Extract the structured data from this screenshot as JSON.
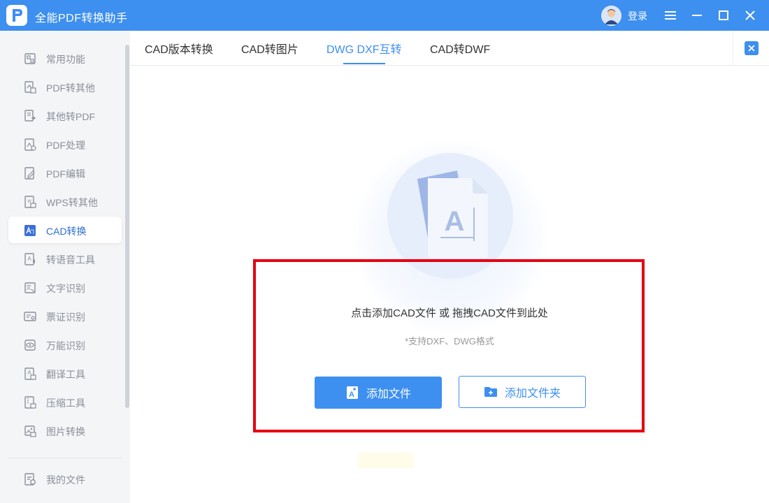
{
  "app": {
    "title": "全能PDF转换助手",
    "login_label": "登录",
    "accent_color": "#3d8ff0"
  },
  "window_controls": [
    "menu-icon",
    "minimize-icon",
    "maximize-icon",
    "close-icon"
  ],
  "sidebar": {
    "items": [
      {
        "label": "常用功能",
        "icon": "common-functions-icon"
      },
      {
        "label": "PDF转其他",
        "icon": "pdf-convert-icon"
      },
      {
        "label": "其他转PDF",
        "icon": "to-pdf-icon"
      },
      {
        "label": "PDF处理",
        "icon": "pdf-process-icon"
      },
      {
        "label": "PDF编辑",
        "icon": "pdf-edit-icon"
      },
      {
        "label": "WPS转其他",
        "icon": "wps-convert-icon"
      },
      {
        "label": "CAD转换",
        "icon": "cad-convert-icon",
        "active": true
      },
      {
        "label": "转语音工具",
        "icon": "text-to-speech-icon"
      },
      {
        "label": "文字识别",
        "icon": "ocr-icon"
      },
      {
        "label": "票证识别",
        "icon": "ticket-recognition-icon"
      },
      {
        "label": "万能识别",
        "icon": "universal-recognition-icon"
      },
      {
        "label": "翻译工具",
        "icon": "translate-icon"
      },
      {
        "label": "压缩工具",
        "icon": "compress-icon"
      },
      {
        "label": "图片转换",
        "icon": "image-convert-icon"
      }
    ],
    "footer_item": {
      "label": "我的文件",
      "icon": "my-files-icon"
    }
  },
  "tabs": [
    {
      "label": "CAD版本转换"
    },
    {
      "label": "CAD转图片"
    },
    {
      "label": "DWG DXF互转",
      "active": true
    },
    {
      "label": "CAD转DWF"
    }
  ],
  "dropzone": {
    "title": "点击添加CAD文件 或 拖拽CAD文件到此处",
    "subtitle": "*支持DXF、DWG格式",
    "add_file_label": "添加文件",
    "add_folder_label": "添加文件夹",
    "highlight_color": "#e60012"
  }
}
